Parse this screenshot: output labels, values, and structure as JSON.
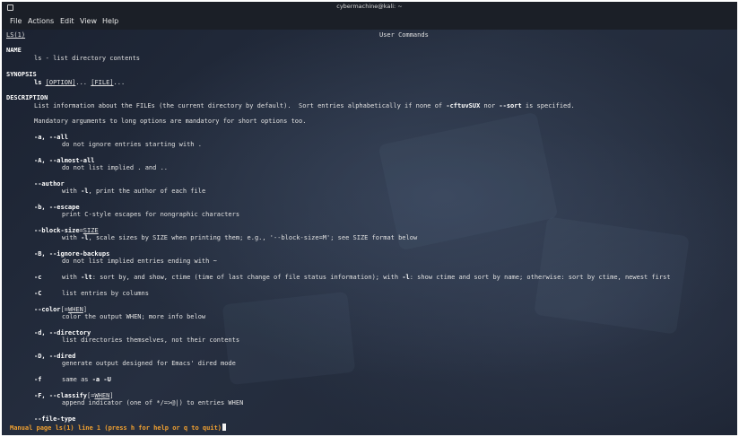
{
  "window": {
    "title": "cybermachine@kali: ~"
  },
  "menu": [
    "File",
    "Actions",
    "Edit",
    "View",
    "Help"
  ],
  "man": {
    "header_left": "LS(1)",
    "header_center": "User Commands",
    "name_heading": "NAME",
    "name_text": "ls - list directory contents",
    "synopsis_heading": "SYNOPSIS",
    "synopsis_cmd": "ls",
    "synopsis_option": "[OPTION]",
    "synopsis_ellipsis1": "...",
    "synopsis_file": "[FILE]",
    "synopsis_ellipsis2": "...",
    "description_heading": "DESCRIPTION",
    "desc_line1_a": "List information about the FILEs (the current directory by default).  Sort entries alphabetically if none of ",
    "desc_line1_b": "-cftuvSUX",
    "desc_line1_c": " nor ",
    "desc_line1_d": "--sort",
    "desc_line1_e": " is specified.",
    "desc_line2": "Mandatory arguments to long options are mandatory for short options too.",
    "opt_a": "-a, --all",
    "opt_a_desc": "do not ignore entries starting with .",
    "opt_A": "-A, --almost-all",
    "opt_A_desc": "do not list implied . and ..",
    "opt_author": "--author",
    "opt_author_desc_a": "with ",
    "opt_author_desc_b": "-l",
    "opt_author_desc_c": ", print the author of each file",
    "opt_b": "-b, --escape",
    "opt_b_desc": "print C-style escapes for nongraphic characters",
    "opt_bs": "--block-size",
    "opt_bs_eq": "=",
    "opt_bs_arg": "SIZE",
    "opt_bs_desc_a": "with ",
    "opt_bs_desc_b": "-l",
    "opt_bs_desc_c": ", scale sizes by SIZE when printing them; e.g., '--block-size=M'; see SIZE format below",
    "opt_B": "-B, --ignore-backups",
    "opt_B_desc": "do not list implied entries ending with ~",
    "opt_c": "-c",
    "opt_c_desc_a": "with ",
    "opt_c_desc_b": "-lt",
    "opt_c_desc_c": ": sort by, and show, ctime (time of last change of file status information); with ",
    "opt_c_desc_d": "-l",
    "opt_c_desc_e": ": show ctime and sort by name; otherwise: sort by ctime, newest first",
    "opt_C": "-C",
    "opt_C_desc": "list entries by columns",
    "opt_color": "--color",
    "opt_color_arg_a": "[=",
    "opt_color_arg_b": "WHEN",
    "opt_color_arg_c": "]",
    "opt_color_desc": "color the output WHEN; more info below",
    "opt_d": "-d, --directory",
    "opt_d_desc": "list directories themselves, not their contents",
    "opt_D": "-D, --dired",
    "opt_D_desc": "generate output designed for Emacs' dired mode",
    "opt_f": "-f",
    "opt_f_desc_a": "same as ",
    "opt_f_desc_b": "-a -U",
    "opt_F": "-F, --classify",
    "opt_F_arg_a": "[=",
    "opt_F_arg_b": "WHEN",
    "opt_F_arg_c": "]",
    "opt_F_desc": "append indicator (one of */=>@|) to entries WHEN",
    "opt_filetype": "--file-type"
  },
  "status_line": "Manual page ls(1) line 1 (press h for help or q to quit)"
}
